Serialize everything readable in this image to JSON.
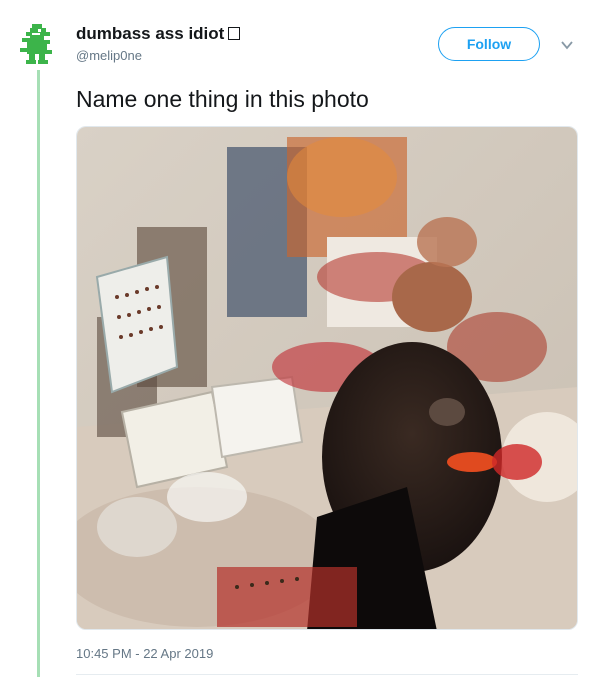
{
  "author": {
    "display_name": "dumbass ass idiot",
    "handle": "@melip0ne",
    "avatar_icon": "green-dinosaur-icon"
  },
  "follow_label": "Follow",
  "menu_icon": "chevron-down-icon",
  "tweet": {
    "text": "Name one thing in this photo",
    "timestamp": "10:45 PM - 22 Apr 2019"
  },
  "colors": {
    "accent": "#1da1f2",
    "thread_line": "#a6dfb5",
    "muted_text": "#657786",
    "text": "#14171a"
  }
}
